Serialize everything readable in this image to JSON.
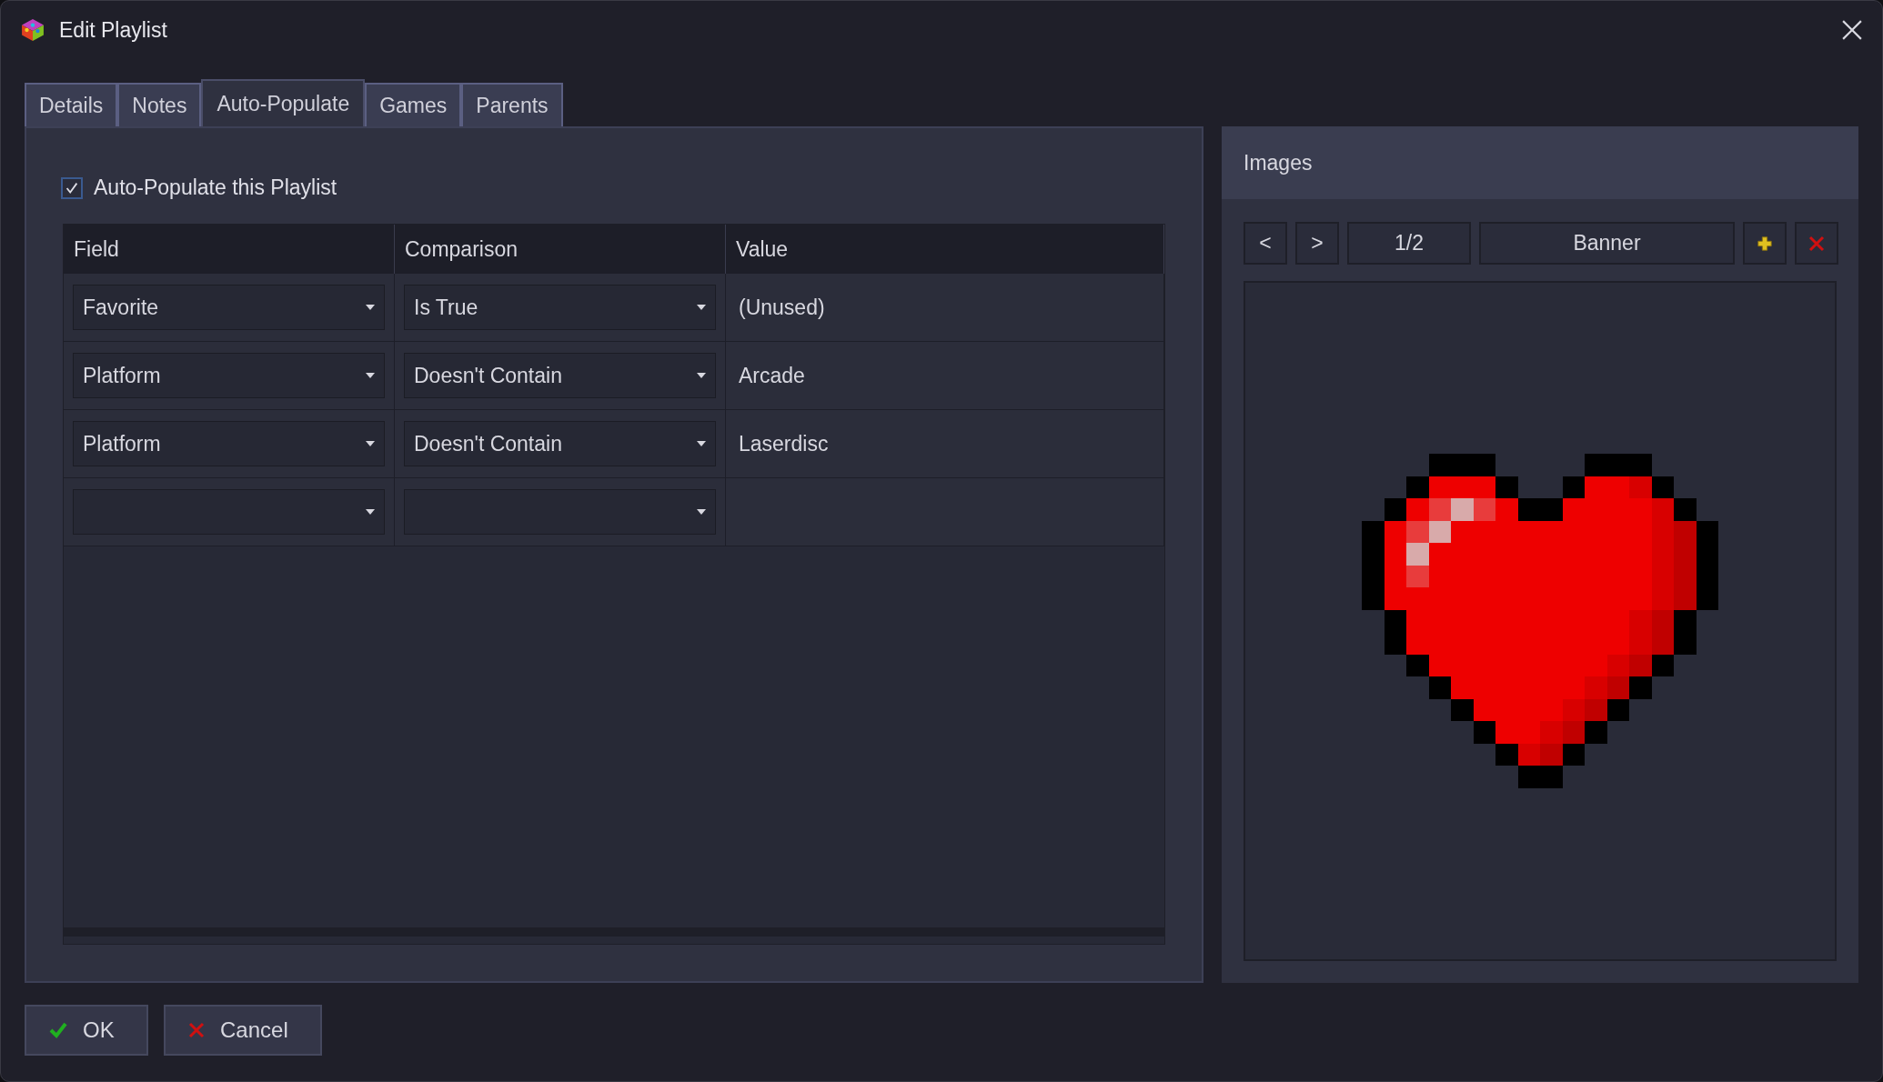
{
  "window": {
    "title": "Edit Playlist"
  },
  "tabs": [
    {
      "label": "Details",
      "selected": false
    },
    {
      "label": "Notes",
      "selected": false
    },
    {
      "label": "Auto-Populate",
      "selected": true
    },
    {
      "label": "Games",
      "selected": false
    },
    {
      "label": "Parents",
      "selected": false
    }
  ],
  "auto_populate": {
    "label": "Auto-Populate this Playlist",
    "checked": true
  },
  "table": {
    "columns": [
      "Field",
      "Comparison",
      "Value"
    ],
    "rows": [
      {
        "field": "Favorite",
        "comparison": "Is True",
        "value": "(Unused)"
      },
      {
        "field": "Platform",
        "comparison": "Doesn't Contain",
        "value": "Arcade"
      },
      {
        "field": "Platform",
        "comparison": "Doesn't Contain",
        "value": "Laserdisc"
      },
      {}
    ]
  },
  "images": {
    "title": "Images",
    "prev": "<",
    "next": ">",
    "counter": "1/2",
    "image_type": "Banner"
  },
  "buttons": [
    {
      "label": "OK",
      "kind": "ok"
    },
    {
      "label": "Cancel",
      "kind": "cancel"
    }
  ]
}
